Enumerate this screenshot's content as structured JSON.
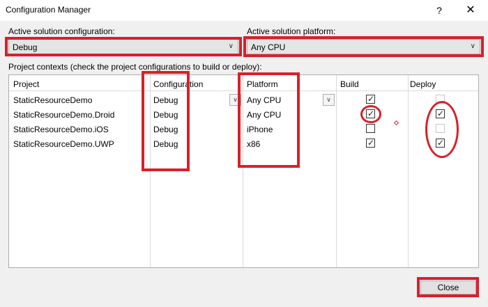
{
  "window": {
    "title": "Configuration Manager",
    "help_label": "?",
    "close_label": "✕"
  },
  "solution_config": {
    "label": "Active solution configuration:",
    "value": "Debug"
  },
  "solution_platform": {
    "label": "Active solution platform:",
    "value": "Any CPU"
  },
  "contexts_label": "Project contexts (check the project configurations to build or deploy):",
  "columns": [
    "Project",
    "Configuration",
    "Platform",
    "Build",
    "Deploy"
  ],
  "rows": [
    {
      "project": "StaticResourceDemo",
      "configuration": "Debug",
      "platform": "Any CPU",
      "build": true,
      "deploy": false,
      "deploy_enabled": false
    },
    {
      "project": "StaticResourceDemo.Droid",
      "configuration": "Debug",
      "platform": "Any CPU",
      "build": true,
      "deploy": true,
      "deploy_enabled": true
    },
    {
      "project": "StaticResourceDemo.iOS",
      "configuration": "Debug",
      "platform": "iPhone",
      "build": false,
      "deploy": false,
      "deploy_enabled": false
    },
    {
      "project": "StaticResourceDemo.UWP",
      "configuration": "Debug",
      "platform": "x86",
      "build": true,
      "deploy": true,
      "deploy_enabled": true
    }
  ],
  "buttons": {
    "close": "Close"
  },
  "colors": {
    "annotation": "#d8202a",
    "window_bg": "#f0f0f0"
  }
}
